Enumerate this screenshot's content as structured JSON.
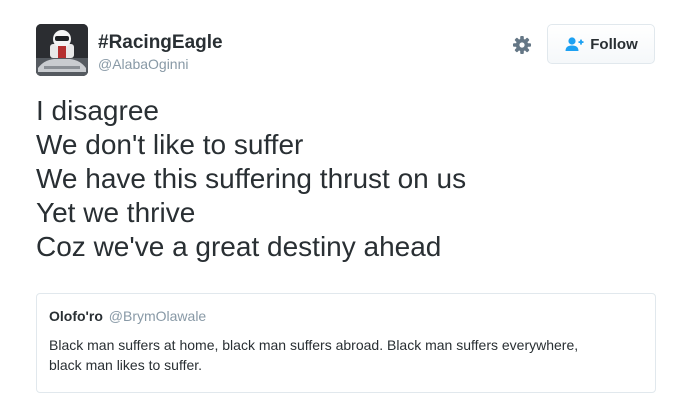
{
  "author": {
    "display_name": "#RacingEagle",
    "screen_name": "@AlabaOginni",
    "avatar_icon": "helmet-and-car-avatar"
  },
  "actions": {
    "settings_icon": "gear-icon",
    "follow_icon": "add-user-icon",
    "follow_label": "Follow"
  },
  "tweet": {
    "lines": [
      "I disagree",
      "We don't like to suffer",
      "We have this suffering thrust on us",
      "Yet we thrive",
      "Coz we've a great destiny ahead"
    ]
  },
  "quoted_tweet": {
    "name": "Olofo'ro",
    "handle": "@BrymOlawale",
    "text": "Black man suffers at home, black man suffers abroad. Black man suffers everywhere, black man likes to suffer."
  },
  "colors": {
    "text": "#292f33",
    "muted": "#8899a6",
    "border": "#e1e8ed",
    "link": "#1da1f2"
  }
}
